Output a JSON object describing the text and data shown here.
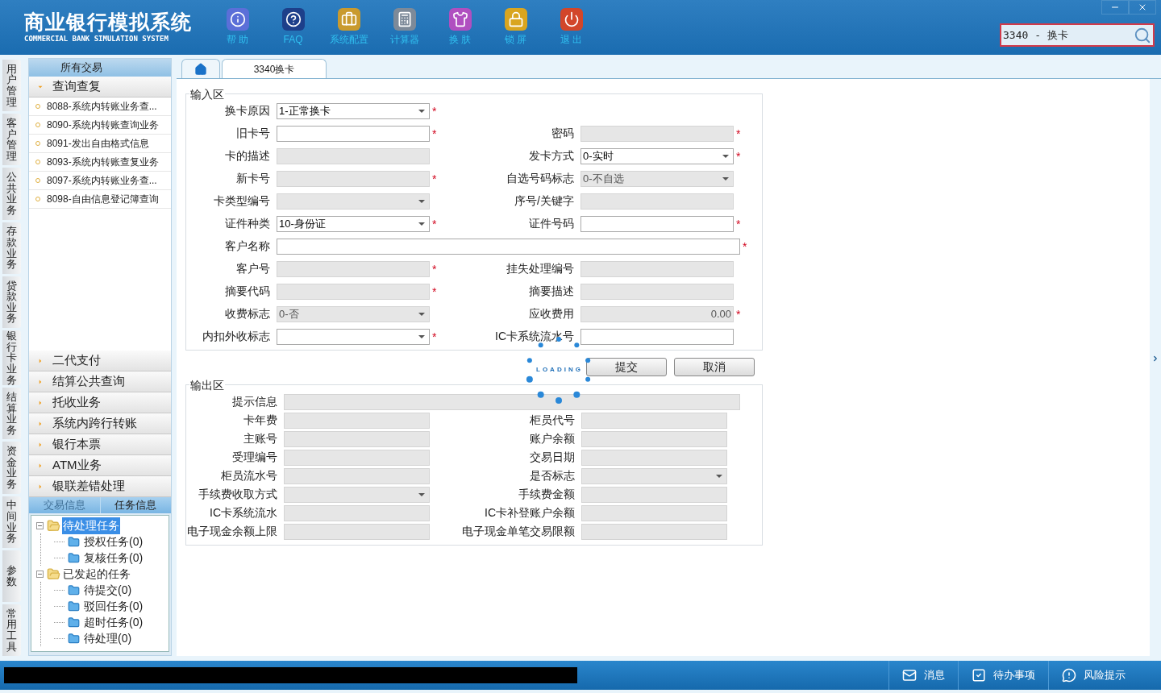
{
  "header": {
    "title": "商业银行模拟系统",
    "subtitle": "COMMERCIAL BANK SIMULATION SYSTEM",
    "nav": [
      {
        "label": "帮 助",
        "kind": "info"
      },
      {
        "label": "FAQ",
        "kind": "faq"
      },
      {
        "label": "系统配置",
        "kind": "config"
      },
      {
        "label": "计算器",
        "kind": "calculator"
      },
      {
        "label": "换 肤",
        "kind": "skin"
      },
      {
        "label": "锁 屏",
        "kind": "lock"
      },
      {
        "label": "退 出",
        "kind": "exit"
      }
    ],
    "search": {
      "value": "3340 - 换卡"
    }
  },
  "side_tabs": [
    "用户管理",
    "客户管理",
    "公共业务",
    "存款业务",
    "贷款业务",
    "银行卡业务",
    "结算业务",
    "资金业务",
    "中间业务",
    "参数",
    "常用工具"
  ],
  "sidebar": {
    "title": "所有交易",
    "groups": [
      {
        "label": "查询查复",
        "expanded": true,
        "items": [
          "8088-系统内转账业务查...",
          "8090-系统内转账查询业务",
          "8091-发出自由格式信息",
          "8093-系统内转账查复业务",
          "8097-系统内转账业务查...",
          "8098-自由信息登记簿查询"
        ]
      },
      {
        "label": "二代支付",
        "expanded": false
      },
      {
        "label": "结算公共查询",
        "expanded": false
      },
      {
        "label": "托收业务",
        "expanded": false
      },
      {
        "label": "系统内跨行转账",
        "expanded": false
      },
      {
        "label": "银行本票",
        "expanded": false
      },
      {
        "label": "ATM业务",
        "expanded": false
      },
      {
        "label": "银联差错处理",
        "expanded": false
      }
    ],
    "info_tabs": [
      {
        "label": "交易信息",
        "selected": false
      },
      {
        "label": "任务信息",
        "selected": true
      }
    ],
    "tree": [
      {
        "label": "待处理任务",
        "selected": true,
        "expanded": true,
        "children": [
          {
            "label": "授权任务(0)",
            "selected": false
          },
          {
            "label": "复核任务(0)",
            "selected": false
          }
        ]
      },
      {
        "label": "已发起的任务",
        "selected": false,
        "expanded": true,
        "children": [
          {
            "label": "待提交(0)",
            "selected": false
          },
          {
            "label": "驳回任务(0)",
            "selected": false
          },
          {
            "label": "超时任务(0)",
            "selected": false
          },
          {
            "label": "待处理(0)",
            "selected": false
          }
        ]
      }
    ]
  },
  "tabs": [
    {
      "kind": "home",
      "selected": false
    },
    {
      "kind": "page",
      "label": "3340换卡",
      "selected": true
    }
  ],
  "required_mark": "*",
  "input_area": {
    "title": "输入区",
    "rows": [
      [
        {
          "label": "换卡原因",
          "kind": "select",
          "value": "1-正常换卡",
          "disabled": false,
          "required": true
        }
      ],
      [
        {
          "label": "旧卡号",
          "kind": "text",
          "disabled": false,
          "required": true
        },
        {
          "label": "密码",
          "kind": "text",
          "disabled": true,
          "required": true
        }
      ],
      [
        {
          "label": "卡的描述",
          "kind": "text",
          "disabled": true,
          "required": false
        },
        {
          "label": "发卡方式",
          "kind": "select",
          "value": "0-实时",
          "disabled": false,
          "required": true
        }
      ],
      [
        {
          "label": "新卡号",
          "kind": "text",
          "disabled": true,
          "required": true
        },
        {
          "label": "自选号码标志",
          "kind": "select",
          "value": "0-不自选",
          "disabled": true,
          "required": false
        }
      ],
      [
        {
          "label": "卡类型编号",
          "kind": "select",
          "disabled": true,
          "required": false
        },
        {
          "label": "序号/关键字",
          "kind": "text",
          "disabled": true,
          "required": false
        }
      ],
      [
        {
          "label": "证件种类",
          "kind": "select",
          "value": "10-身份证",
          "disabled": false,
          "required": true
        },
        {
          "label": "证件号码",
          "kind": "text",
          "disabled": false,
          "required": true
        }
      ],
      [
        {
          "label": "客户名称",
          "kind": "text",
          "full": true,
          "disabled": false,
          "required": true
        }
      ],
      [
        {
          "label": "客户号",
          "kind": "text",
          "disabled": true,
          "required": true
        },
        {
          "label": "挂失处理编号",
          "kind": "text",
          "disabled": true,
          "required": false
        }
      ],
      [
        {
          "label": "摘要代码",
          "kind": "text",
          "disabled": true,
          "required": true
        },
        {
          "label": "摘要描述",
          "kind": "text",
          "disabled": true,
          "required": false
        }
      ],
      [
        {
          "label": "收费标志",
          "kind": "select",
          "value": "0-否",
          "disabled": true,
          "required": false
        },
        {
          "label": "应收费用",
          "kind": "amount",
          "value": "0.00",
          "disabled": true,
          "required": true
        }
      ],
      [
        {
          "label": "内扣外收标志",
          "kind": "select",
          "disabled": false,
          "required": true
        },
        {
          "label": "IC卡系统流水号",
          "kind": "text",
          "disabled": false,
          "required": false
        }
      ]
    ]
  },
  "buttons": [
    "提交",
    "取消"
  ],
  "loading": {
    "text": "LOADING"
  },
  "output_area": {
    "title": "输出区",
    "rows": [
      [
        {
          "label": "提示信息",
          "kind": "text",
          "full": true,
          "disabled": true
        }
      ],
      [
        {
          "label": "卡年费",
          "kind": "text",
          "disabled": true
        },
        {
          "label": "柜员代号",
          "kind": "text",
          "disabled": true
        }
      ],
      [
        {
          "label": "主账号",
          "kind": "text",
          "disabled": true
        },
        {
          "label": "账户余额",
          "kind": "text",
          "disabled": true
        }
      ],
      [
        {
          "label": "受理编号",
          "kind": "text",
          "disabled": true
        },
        {
          "label": "交易日期",
          "kind": "text",
          "disabled": true
        }
      ],
      [
        {
          "label": "柜员流水号",
          "kind": "text",
          "disabled": true
        },
        {
          "label": "是否标志",
          "kind": "select",
          "disabled": true
        }
      ],
      [
        {
          "label": "手续费收取方式",
          "kind": "select",
          "disabled": true
        },
        {
          "label": "手续费金额",
          "kind": "text",
          "disabled": true
        }
      ],
      [
        {
          "label": "IC卡系统流水",
          "kind": "text",
          "disabled": true
        },
        {
          "label": "IC卡补登账户余额",
          "kind": "text",
          "disabled": true
        }
      ],
      [
        {
          "label": "电子现金余额上限",
          "kind": "text",
          "disabled": true
        },
        {
          "label": "电子现金单笔交易限额",
          "kind": "text",
          "disabled": true
        }
      ]
    ]
  },
  "footer": {
    "items": [
      {
        "label": "消息",
        "kind": "message"
      },
      {
        "label": "待办事项",
        "kind": "todo"
      },
      {
        "label": "风险提示",
        "kind": "risk"
      }
    ]
  }
}
